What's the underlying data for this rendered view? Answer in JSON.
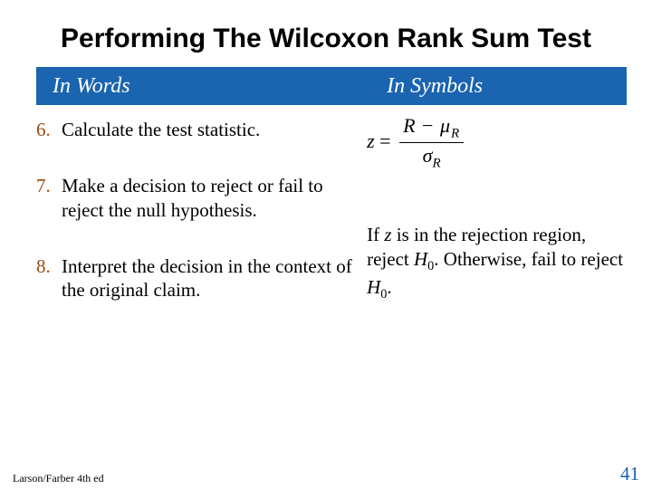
{
  "title": "Performing The Wilcoxon Rank Sum Test",
  "header": {
    "words": "In Words",
    "symbols": "In Symbols"
  },
  "steps": [
    {
      "num": "6.",
      "text": "Calculate the test statistic."
    },
    {
      "num": "7.",
      "text": "Make a decision to reject or fail to reject the null hypothesis."
    },
    {
      "num": "8.",
      "text": "Interpret the decision in the context of the original claim."
    }
  ],
  "formula": {
    "z": "z",
    "eq": " = ",
    "R": "R",
    "minus": " − ",
    "mu": "μ",
    "sigma": "σ",
    "subR": "R"
  },
  "symbols_text": {
    "pre": "If ",
    "z": "z",
    "mid": " is in the rejection region, reject ",
    "H": "H",
    "zero": "0",
    "after1": ". Otherwise, fail to reject ",
    "after2": "."
  },
  "footer": {
    "source": "Larson/Farber 4th ed",
    "page": "41"
  }
}
